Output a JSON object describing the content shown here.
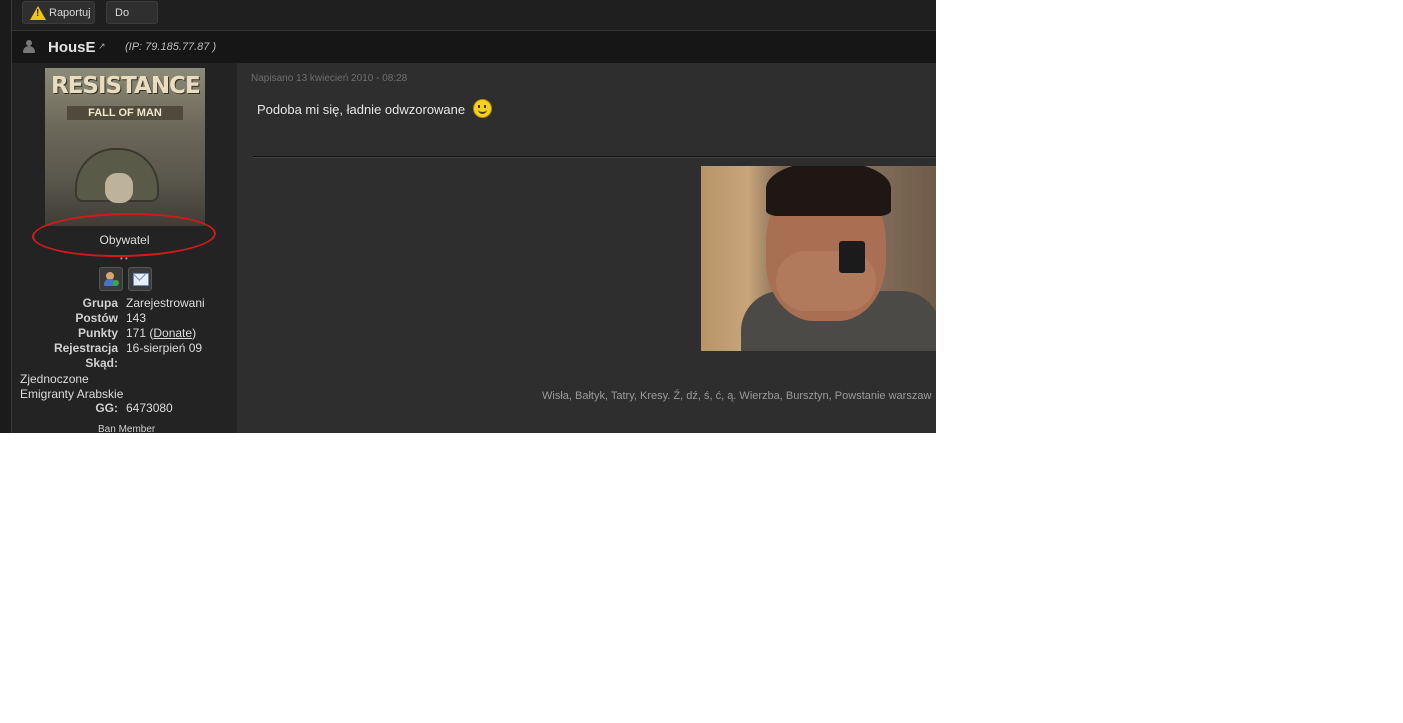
{
  "toolbar": {
    "report_label": "Raportuj",
    "top_label": "Do góry"
  },
  "post_header": {
    "username": "HousE",
    "external_link_icon": "↗",
    "ip": "(IP: 79.185.77.87 )"
  },
  "profile": {
    "avatar_title": "RESISTANCE",
    "avatar_subtitle": "FALL OF MAN",
    "rank": "Obywatel",
    "pips": "• •",
    "fields": [
      {
        "label": "Grupa",
        "value": "Zarejestrowani"
      },
      {
        "label": "Postów",
        "value": "143"
      },
      {
        "label": "Punkty",
        "value": "171 (",
        "link": "Donate",
        "suffix": ")"
      },
      {
        "label": "Rejestracja",
        "value": "16-sierpień 09"
      },
      {
        "label": "Skąd:",
        "value": ""
      }
    ],
    "location_line1": "Zjednoczone",
    "location_line2": "Emigranty Arabskie",
    "gg_label": "GG:",
    "gg_value": "6473080",
    "ban_label": "Ban Member"
  },
  "post": {
    "posted": "Napisano 13 kwiecień 2010 - 08:28",
    "message": "Podoba mi się, ładnie odwzorowane",
    "signature_text": "Wisła, Bałtyk, Tatry, Kresy. Ź, dź, ś, ć, ą. Wierzba, Bursztyn, Powstanie warszaw"
  },
  "colors": {
    "annotation_circle": "#d31a1a",
    "warning_icon": "#f2c318"
  },
  "icons": {
    "report": "warning-icon",
    "user": "user-icon",
    "add_friend": "add-friend-icon",
    "message": "message-icon",
    "smiley": "smiley-icon"
  }
}
